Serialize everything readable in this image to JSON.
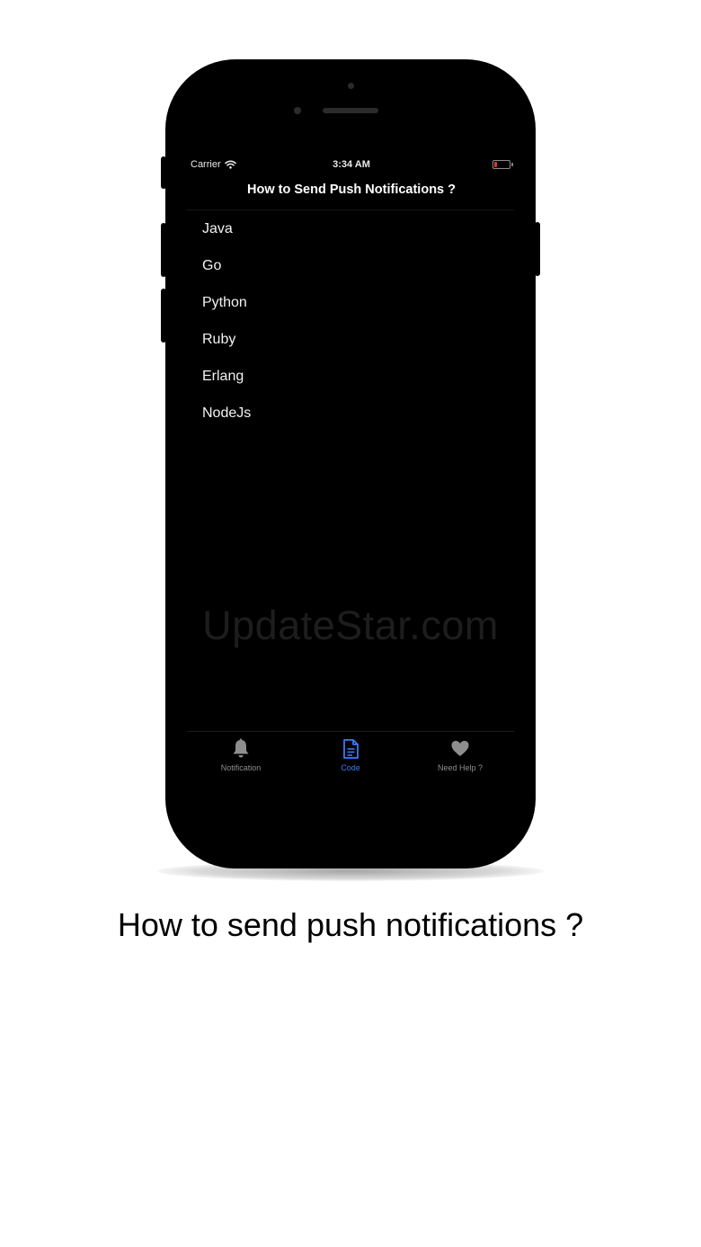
{
  "status_bar": {
    "carrier": "Carrier",
    "time": "3:34 AM"
  },
  "nav": {
    "title": "How to Send Push Notifications ?"
  },
  "list": {
    "items": [
      "Java",
      "Go",
      "Python",
      "Ruby",
      "Erlang",
      "NodeJs"
    ]
  },
  "watermark": "UpdateStar.com",
  "tab_bar": {
    "tabs": [
      {
        "label": "Notification",
        "icon": "bell-icon",
        "selected": false
      },
      {
        "label": "Code",
        "icon": "document-icon",
        "selected": true
      },
      {
        "label": "Need Help ?",
        "icon": "heart-icon",
        "selected": false
      }
    ]
  },
  "caption": "How to send push notifications ?",
  "colors": {
    "accent": "#3a7bf2",
    "tab_inactive": "#8e8e8e",
    "battery_low": "#e0322f"
  }
}
